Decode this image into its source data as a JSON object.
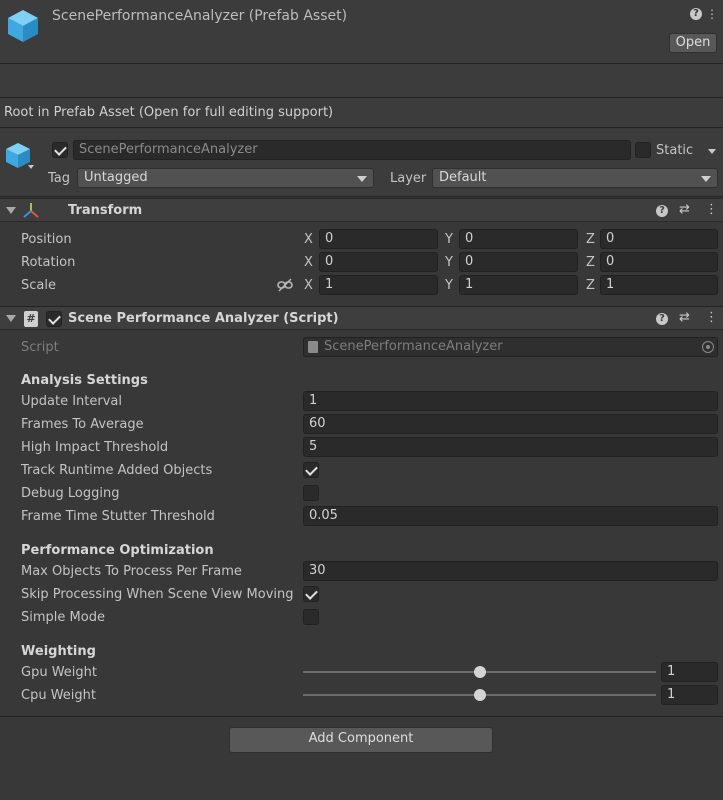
{
  "header": {
    "title": "ScenePerformanceAnalyzer (Prefab Asset)",
    "open_label": "Open"
  },
  "root_message": "Root in Prefab Asset (Open for full editing support)",
  "gameobject": {
    "name": "ScenePerformanceAnalyzer",
    "static_label": "Static",
    "tag_label": "Tag",
    "tag_value": "Untagged",
    "layer_label": "Layer",
    "layer_value": "Default"
  },
  "transform": {
    "title": "Transform",
    "rows": [
      {
        "label": "Position",
        "x": "0",
        "y": "0",
        "z": "0"
      },
      {
        "label": "Rotation",
        "x": "0",
        "y": "0",
        "z": "0"
      },
      {
        "label": "Scale",
        "x": "1",
        "y": "1",
        "z": "1"
      }
    ],
    "axes": {
      "x": "X",
      "y": "Y",
      "z": "Z"
    }
  },
  "script_component": {
    "title": "Scene Performance Analyzer (Script)",
    "script_label": "Script",
    "script_value": "ScenePerformanceAnalyzer",
    "analysis": {
      "header": "Analysis Settings",
      "update_interval": {
        "label": "Update Interval",
        "value": "1"
      },
      "frames_to_average": {
        "label": "Frames To Average",
        "value": "60"
      },
      "high_impact_threshold": {
        "label": "High Impact Threshold",
        "value": "5"
      },
      "track_runtime": {
        "label": "Track Runtime Added Objects",
        "checked": true
      },
      "debug_logging": {
        "label": "Debug Logging",
        "checked": false
      },
      "frame_time_stutter": {
        "label": "Frame Time Stutter Threshold",
        "value": "0.05"
      }
    },
    "optimization": {
      "header": "Performance Optimization",
      "max_objects": {
        "label": "Max Objects To Process Per Frame",
        "value": "30"
      },
      "skip_processing": {
        "label": "Skip Processing When Scene View Moving",
        "checked": true
      },
      "simple_mode": {
        "label": "Simple Mode",
        "checked": false
      }
    },
    "weighting": {
      "header": "Weighting",
      "gpu": {
        "label": "Gpu Weight",
        "value": "1",
        "fraction": 0.5
      },
      "cpu": {
        "label": "Cpu Weight",
        "value": "1",
        "fraction": 0.5
      }
    }
  },
  "add_component_label": "Add Component",
  "icons": {
    "help": "help-icon",
    "presets": "presets-icon",
    "menu": "kebab-menu-icon",
    "link": "link-icon",
    "cube": "prefab-cube-icon"
  }
}
